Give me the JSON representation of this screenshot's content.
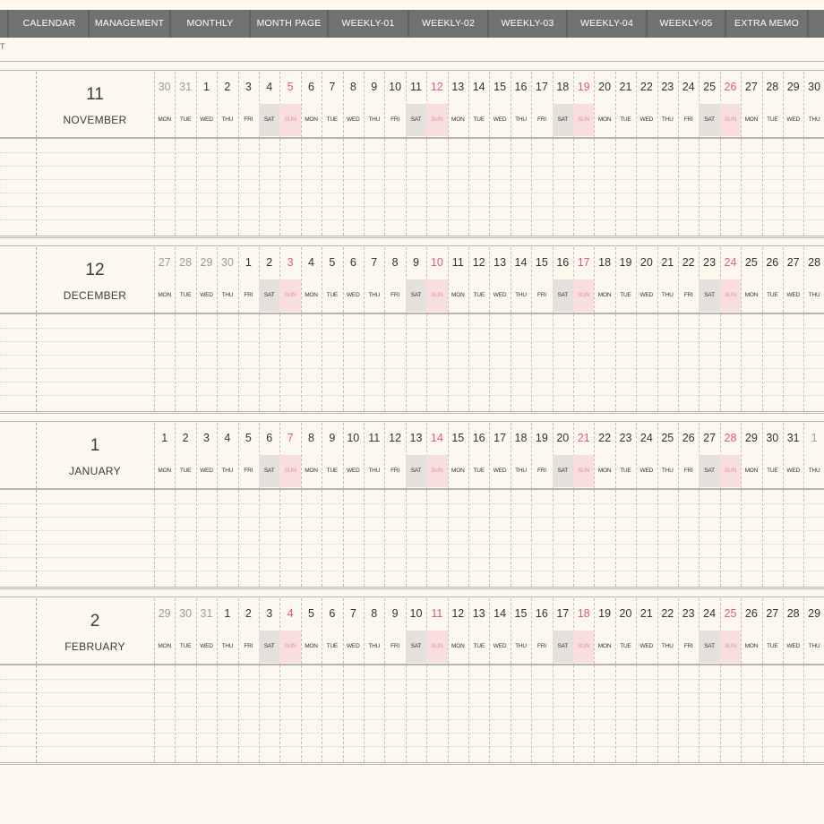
{
  "nav": {
    "items": [
      "CALENDAR",
      "MANAGEMENT",
      "MONTHLY",
      "MONTH PAGE",
      "WEEKLY-01",
      "WEEKLY-02",
      "WEEKLY-03",
      "WEEKLY-04",
      "WEEKLY-05",
      "EXTRA MEMO"
    ]
  },
  "corner_glyph": "T",
  "months": [
    {
      "number": "11",
      "name": "NOVEMBER",
      "days": [
        {
          "n": "30",
          "w": "MON",
          "t": "gray"
        },
        {
          "n": "31",
          "w": "TUE",
          "t": "gray"
        },
        {
          "n": "1",
          "w": "WED"
        },
        {
          "n": "2",
          "w": "THU"
        },
        {
          "n": "3",
          "w": "FRI"
        },
        {
          "n": "4",
          "w": "SAT"
        },
        {
          "n": "5",
          "w": "SUN"
        },
        {
          "n": "6",
          "w": "MON"
        },
        {
          "n": "7",
          "w": "TUE"
        },
        {
          "n": "8",
          "w": "WED"
        },
        {
          "n": "9",
          "w": "THU"
        },
        {
          "n": "10",
          "w": "FRI"
        },
        {
          "n": "11",
          "w": "SAT"
        },
        {
          "n": "12",
          "w": "SUN"
        },
        {
          "n": "13",
          "w": "MON"
        },
        {
          "n": "14",
          "w": "TUE"
        },
        {
          "n": "15",
          "w": "WED"
        },
        {
          "n": "16",
          "w": "THU"
        },
        {
          "n": "17",
          "w": "FRI"
        },
        {
          "n": "18",
          "w": "SAT"
        },
        {
          "n": "19",
          "w": "SUN"
        },
        {
          "n": "20",
          "w": "MON"
        },
        {
          "n": "21",
          "w": "TUE"
        },
        {
          "n": "22",
          "w": "WED"
        },
        {
          "n": "23",
          "w": "THU"
        },
        {
          "n": "24",
          "w": "FRI"
        },
        {
          "n": "25",
          "w": "SAT"
        },
        {
          "n": "26",
          "w": "SUN"
        },
        {
          "n": "27",
          "w": "MON"
        },
        {
          "n": "28",
          "w": "TUE"
        },
        {
          "n": "29",
          "w": "WED"
        },
        {
          "n": "30",
          "w": "THU"
        }
      ]
    },
    {
      "number": "12",
      "name": "DECEMBER",
      "days": [
        {
          "n": "27",
          "w": "MON",
          "t": "gray"
        },
        {
          "n": "28",
          "w": "TUE",
          "t": "gray"
        },
        {
          "n": "29",
          "w": "WED",
          "t": "gray"
        },
        {
          "n": "30",
          "w": "THU",
          "t": "gray"
        },
        {
          "n": "1",
          "w": "FRI"
        },
        {
          "n": "2",
          "w": "SAT"
        },
        {
          "n": "3",
          "w": "SUN"
        },
        {
          "n": "4",
          "w": "MON"
        },
        {
          "n": "5",
          "w": "TUE"
        },
        {
          "n": "6",
          "w": "WED"
        },
        {
          "n": "7",
          "w": "THU"
        },
        {
          "n": "8",
          "w": "FRI"
        },
        {
          "n": "9",
          "w": "SAT"
        },
        {
          "n": "10",
          "w": "SUN"
        },
        {
          "n": "11",
          "w": "MON"
        },
        {
          "n": "12",
          "w": "TUE"
        },
        {
          "n": "13",
          "w": "WED"
        },
        {
          "n": "14",
          "w": "THU"
        },
        {
          "n": "15",
          "w": "FRI"
        },
        {
          "n": "16",
          "w": "SAT"
        },
        {
          "n": "17",
          "w": "SUN"
        },
        {
          "n": "18",
          "w": "MON"
        },
        {
          "n": "19",
          "w": "TUE"
        },
        {
          "n": "20",
          "w": "WED"
        },
        {
          "n": "21",
          "w": "THU"
        },
        {
          "n": "22",
          "w": "FRI"
        },
        {
          "n": "23",
          "w": "SAT"
        },
        {
          "n": "24",
          "w": "SUN"
        },
        {
          "n": "25",
          "w": "MON"
        },
        {
          "n": "26",
          "w": "TUE"
        },
        {
          "n": "27",
          "w": "WED"
        },
        {
          "n": "28",
          "w": "THU"
        }
      ]
    },
    {
      "number": "1",
      "name": "JANUARY",
      "days": [
        {
          "n": "1",
          "w": "MON"
        },
        {
          "n": "2",
          "w": "TUE"
        },
        {
          "n": "3",
          "w": "WED"
        },
        {
          "n": "4",
          "w": "THU"
        },
        {
          "n": "5",
          "w": "FRI"
        },
        {
          "n": "6",
          "w": "SAT"
        },
        {
          "n": "7",
          "w": "SUN"
        },
        {
          "n": "8",
          "w": "MON"
        },
        {
          "n": "9",
          "w": "TUE"
        },
        {
          "n": "10",
          "w": "WED"
        },
        {
          "n": "11",
          "w": "THU"
        },
        {
          "n": "12",
          "w": "FRI"
        },
        {
          "n": "13",
          "w": "SAT"
        },
        {
          "n": "14",
          "w": "SUN"
        },
        {
          "n": "15",
          "w": "MON"
        },
        {
          "n": "16",
          "w": "TUE"
        },
        {
          "n": "17",
          "w": "WED"
        },
        {
          "n": "18",
          "w": "THU"
        },
        {
          "n": "19",
          "w": "FRI"
        },
        {
          "n": "20",
          "w": "SAT"
        },
        {
          "n": "21",
          "w": "SUN"
        },
        {
          "n": "22",
          "w": "MON"
        },
        {
          "n": "23",
          "w": "TUE"
        },
        {
          "n": "24",
          "w": "WED"
        },
        {
          "n": "25",
          "w": "THU"
        },
        {
          "n": "26",
          "w": "FRI"
        },
        {
          "n": "27",
          "w": "SAT"
        },
        {
          "n": "28",
          "w": "SUN"
        },
        {
          "n": "29",
          "w": "MON"
        },
        {
          "n": "30",
          "w": "TUE"
        },
        {
          "n": "31",
          "w": "WED"
        },
        {
          "n": "1",
          "w": "THU",
          "t": "gray"
        }
      ]
    },
    {
      "number": "2",
      "name": "FEBRUARY",
      "days": [
        {
          "n": "29",
          "w": "MON",
          "t": "gray"
        },
        {
          "n": "30",
          "w": "TUE",
          "t": "gray"
        },
        {
          "n": "31",
          "w": "WED",
          "t": "gray"
        },
        {
          "n": "1",
          "w": "THU"
        },
        {
          "n": "2",
          "w": "FRI"
        },
        {
          "n": "3",
          "w": "SAT"
        },
        {
          "n": "4",
          "w": "SUN"
        },
        {
          "n": "5",
          "w": "MON"
        },
        {
          "n": "6",
          "w": "TUE"
        },
        {
          "n": "7",
          "w": "WED"
        },
        {
          "n": "8",
          "w": "THU"
        },
        {
          "n": "9",
          "w": "FRI"
        },
        {
          "n": "10",
          "w": "SAT"
        },
        {
          "n": "11",
          "w": "SUN"
        },
        {
          "n": "12",
          "w": "MON"
        },
        {
          "n": "13",
          "w": "TUE"
        },
        {
          "n": "14",
          "w": "WED"
        },
        {
          "n": "15",
          "w": "THU"
        },
        {
          "n": "16",
          "w": "FRI"
        },
        {
          "n": "17",
          "w": "SAT"
        },
        {
          "n": "18",
          "w": "SUN"
        },
        {
          "n": "19",
          "w": "MON"
        },
        {
          "n": "20",
          "w": "TUE"
        },
        {
          "n": "21",
          "w": "WED"
        },
        {
          "n": "22",
          "w": "THU"
        },
        {
          "n": "23",
          "w": "FRI"
        },
        {
          "n": "24",
          "w": "SAT"
        },
        {
          "n": "25",
          "w": "SUN"
        },
        {
          "n": "26",
          "w": "MON"
        },
        {
          "n": "27",
          "w": "TUE"
        },
        {
          "n": "28",
          "w": "WED"
        },
        {
          "n": "29",
          "w": "THU"
        }
      ]
    }
  ],
  "colors": {
    "background": "#fdf8ee",
    "nav_bar": "#6f7172",
    "sunday_text": "#e05a78",
    "sunday_fill": "#f9dede",
    "saturday_fill": "#e4e1dc",
    "outside_month_text": "#9b9b9b"
  }
}
